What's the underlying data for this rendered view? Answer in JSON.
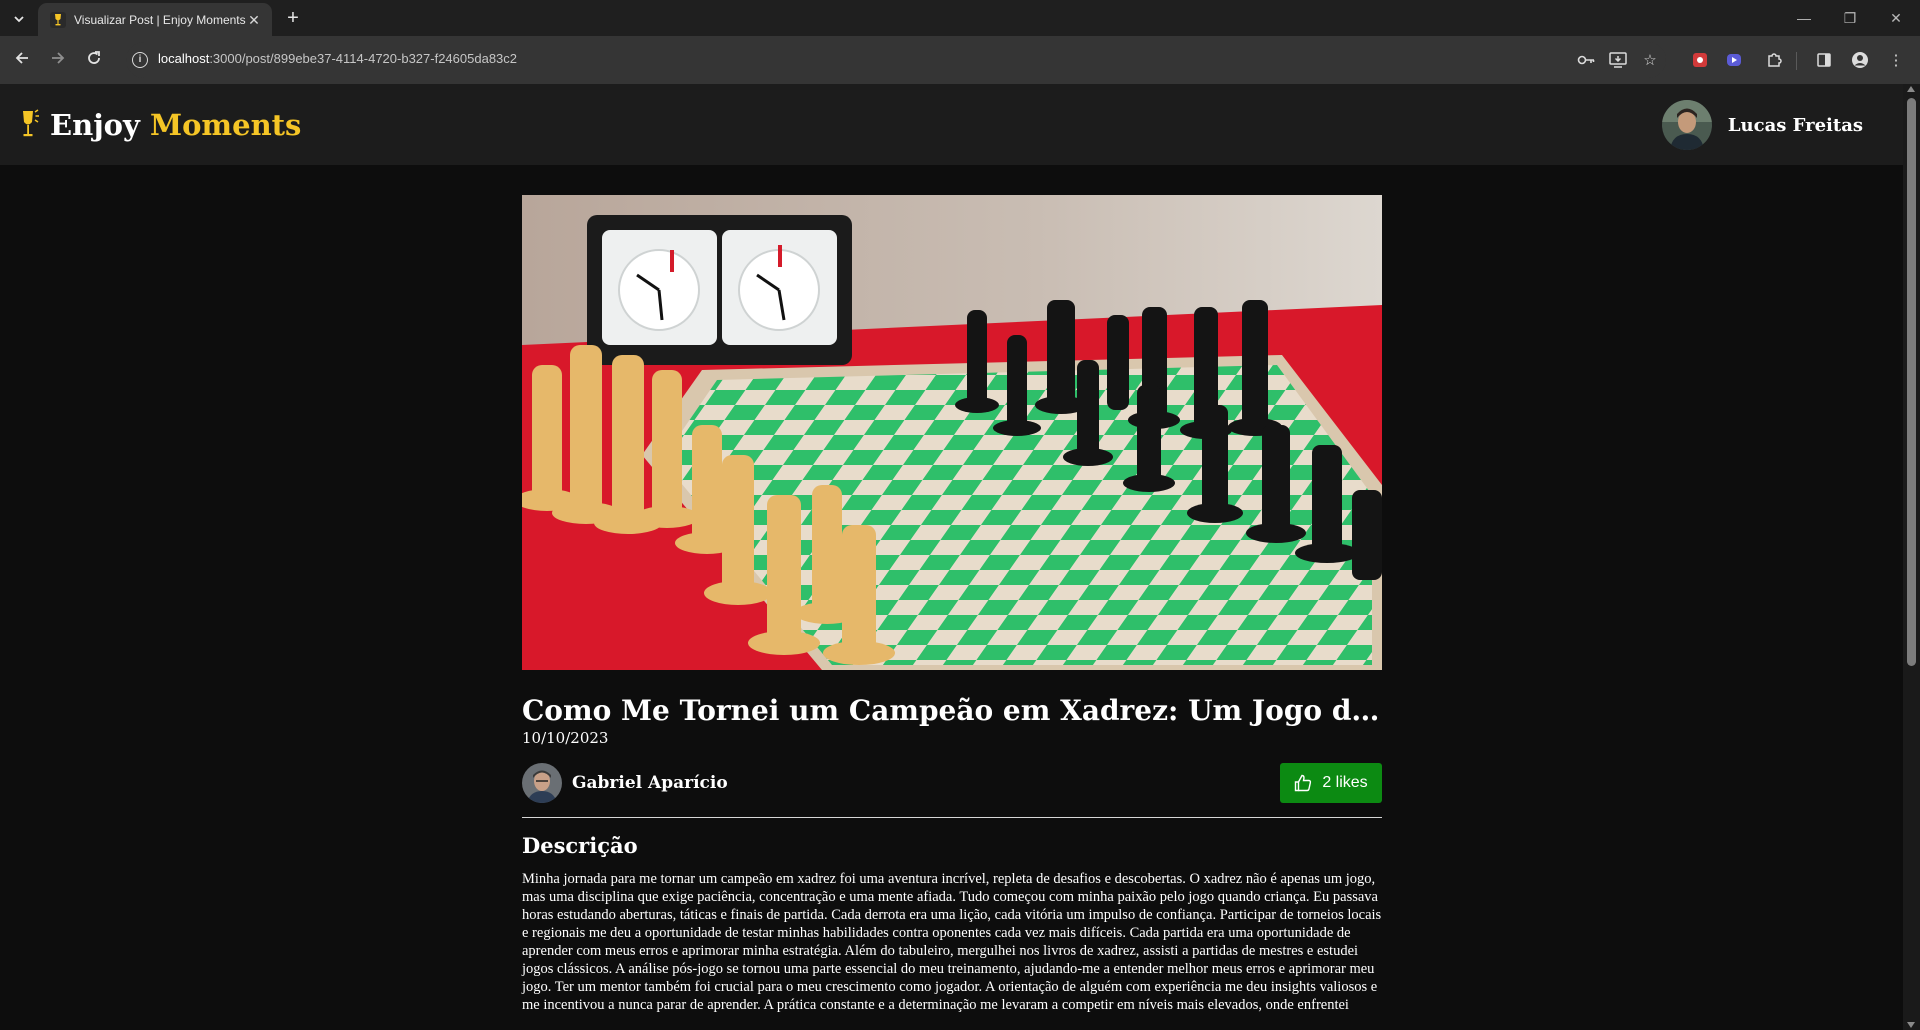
{
  "browser": {
    "tab_title": "Visualizar Post | Enjoy Moments",
    "url_host": "localhost",
    "url_path": ":3000/post/899ebe37-4114-4720-b327-f24605da83c2"
  },
  "header": {
    "brand_first": "Enjoy",
    "brand_second": "Moments",
    "accent_color": "#f5c526",
    "user_name": "Lucas Freitas"
  },
  "post": {
    "title": "Como Me Tornei um Campeão em Xadrez: Um Jogo de Estratégia e Paixão",
    "date": "10/10/2023",
    "author_name": "Gabriel Aparício",
    "likes_label": "2 likes",
    "like_color": "#0c8a12",
    "section_title": "Descrição",
    "description": "Minha jornada para me tornar um campeão em xadrez foi uma aventura incrível, repleta de desafios e descobertas. O xadrez não é apenas um jogo, mas uma disciplina que exige paciência, concentração e uma mente afiada. Tudo começou com minha paixão pelo jogo quando criança. Eu passava horas estudando aberturas, táticas e finais de partida. Cada derrota era uma lição, cada vitória um impulso de confiança. Participar de torneios locais e regionais me deu a oportunidade de testar minhas habilidades contra oponentes cada vez mais difíceis. Cada partida era uma oportunidade de aprender com meus erros e aprimorar minha estratégia. Além do tabuleiro, mergulhei nos livros de xadrez, assisti a partidas de mestres e estudei jogos clássicos. A análise pós-jogo se tornou uma parte essencial do meu treinamento, ajudando-me a entender melhor meus erros e aprimorar meu jogo. Ter um mentor também foi crucial para o meu crescimento como jogador. A orientação de alguém com experiência me deu insights valiosos e me incentivou a nunca parar de aprender. A prática constante e a determinação me levaram a competir em níveis mais elevados, onde enfrentei"
  }
}
